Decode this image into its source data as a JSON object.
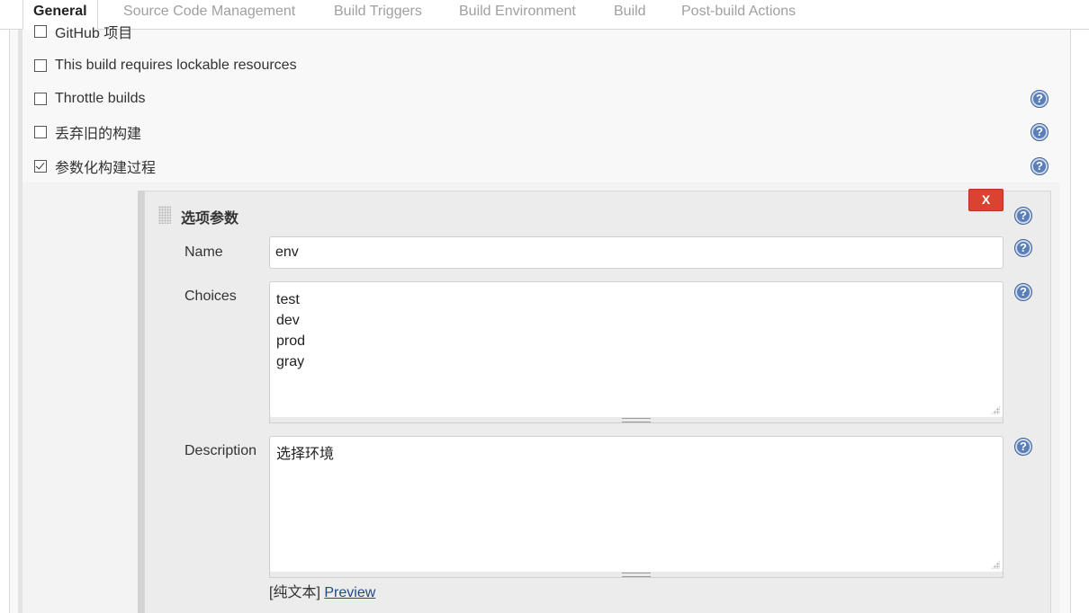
{
  "tabs": [
    {
      "label": "General",
      "active": true
    },
    {
      "label": "Source Code Management",
      "active": false
    },
    {
      "label": "Build Triggers",
      "active": false
    },
    {
      "label": "Build Environment",
      "active": false
    },
    {
      "label": "Build",
      "active": false
    },
    {
      "label": "Post-build Actions",
      "active": false
    }
  ],
  "options": [
    {
      "label": "GitHub 项目",
      "checked": false
    },
    {
      "label": "This build requires lockable resources",
      "checked": false
    },
    {
      "label": "Throttle builds",
      "checked": false
    },
    {
      "label": "丢弃旧的构建",
      "checked": false
    },
    {
      "label": "参数化构建过程",
      "checked": true
    }
  ],
  "parameter": {
    "title": "选项参数",
    "delete_label": "X",
    "name_label": "Name",
    "name_value": "env",
    "choices_label": "Choices",
    "choices_value": "test\ndev\nprod\ngray",
    "description_label": "Description",
    "description_value": "选择环境",
    "syntax_prefix": "[纯文本]",
    "preview_label": "Preview"
  },
  "help_icon": "?",
  "colors": {
    "delete_button": "#d9432f",
    "help_icon": "#5a7fb8",
    "link": "#204a87"
  }
}
